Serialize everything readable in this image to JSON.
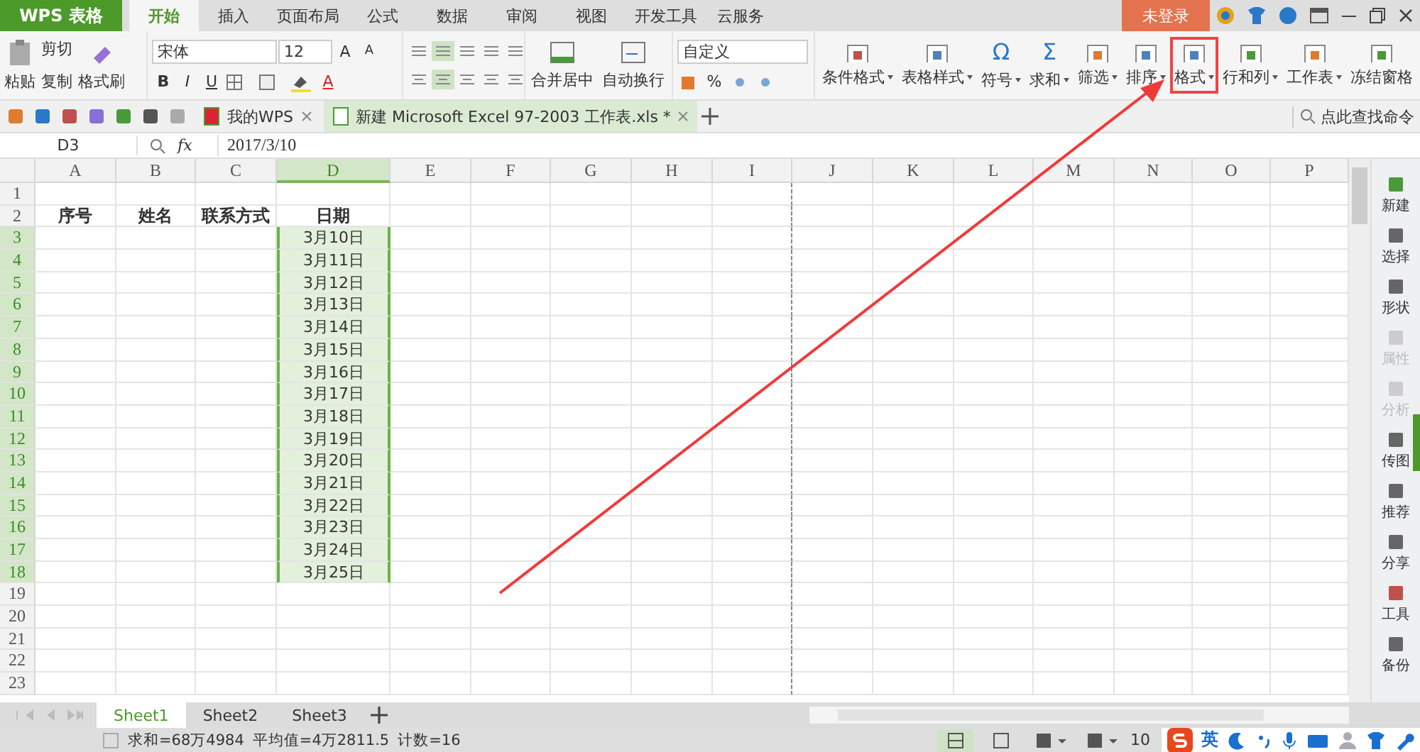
{
  "title_bar": {
    "app_button": "WPS 表格",
    "login": "未登录",
    "tabs": [
      {
        "label": "开始",
        "selected": true
      },
      {
        "label": "插入",
        "selected": false
      },
      {
        "label": "页面布局",
        "selected": false
      },
      {
        "label": "公式",
        "selected": false
      },
      {
        "label": "数据",
        "selected": false
      },
      {
        "label": "审阅",
        "selected": false
      },
      {
        "label": "视图",
        "selected": false
      },
      {
        "label": "开发工具",
        "selected": false
      },
      {
        "label": "云服务",
        "selected": false
      }
    ]
  },
  "ribbon": {
    "paste": "粘贴",
    "cut": "剪切",
    "copy": "复制",
    "format_painter": "格式刷",
    "font_name": "宋体",
    "font_size": "12",
    "grow": "A",
    "shrink": "A",
    "styles": [
      "B",
      "I",
      "U"
    ],
    "font_color": "A",
    "merge": "合并居中",
    "wrap": "自动换行",
    "number_format": "自定义",
    "percent": "%",
    "tools": [
      {
        "label": "条件格式",
        "dropdown": true,
        "highlighted": false
      },
      {
        "label": "表格样式",
        "dropdown": true,
        "highlighted": false
      },
      {
        "label": "符号",
        "glyph": "Ω",
        "dropdown": true,
        "highlighted": false
      },
      {
        "label": "求和",
        "glyph": "Σ",
        "dropdown": true,
        "highlighted": false
      },
      {
        "label": "筛选",
        "dropdown": true,
        "highlighted": false
      },
      {
        "label": "排序",
        "dropdown": true,
        "highlighted": false
      },
      {
        "label": "格式",
        "dropdown": true,
        "highlighted": true
      },
      {
        "label": "行和列",
        "dropdown": true,
        "highlighted": false
      },
      {
        "label": "工作表",
        "dropdown": true,
        "highlighted": false
      },
      {
        "label": "冻结窗格",
        "dropdown": false,
        "highlighted": false
      }
    ],
    "search": "点此查找命令"
  },
  "doc_tabs": [
    {
      "label": "我的WPS",
      "selected": false
    },
    {
      "label": "新建 Microsoft Excel 97-2003 工作表.xls *",
      "selected": true
    }
  ],
  "formula_bar": {
    "cell": "D3",
    "fx": "fx",
    "value": "2017/3/10"
  },
  "sheet": {
    "columns": [
      {
        "label": "A",
        "selected": false
      },
      {
        "label": "B",
        "selected": false
      },
      {
        "label": "C",
        "selected": false
      },
      {
        "label": "D",
        "selected": true
      },
      {
        "label": "E",
        "selected": false
      },
      {
        "label": "F",
        "selected": false
      },
      {
        "label": "G",
        "selected": false
      },
      {
        "label": "H",
        "selected": false
      },
      {
        "label": "I",
        "selected": false
      },
      {
        "label": "J",
        "selected": false
      },
      {
        "label": "K",
        "selected": false
      },
      {
        "label": "L",
        "selected": false
      },
      {
        "label": "M",
        "selected": false
      },
      {
        "label": "N",
        "selected": false
      },
      {
        "label": "O",
        "selected": false
      },
      {
        "label": "P",
        "selected": false
      }
    ],
    "rows": [
      {
        "number": "1",
        "selected": false
      },
      {
        "number": "2",
        "selected": false,
        "headings": [
          "序号",
          "姓名",
          "联系方式",
          "日期"
        ]
      },
      {
        "number": "3",
        "selected": true,
        "date": "3月10日"
      },
      {
        "number": "4",
        "selected": true,
        "date": "3月11日"
      },
      {
        "number": "5",
        "selected": true,
        "date": "3月12日"
      },
      {
        "number": "6",
        "selected": true,
        "date": "3月13日"
      },
      {
        "number": "7",
        "selected": true,
        "date": "3月14日"
      },
      {
        "number": "8",
        "selected": true,
        "date": "3月15日"
      },
      {
        "number": "9",
        "selected": true,
        "date": "3月16日"
      },
      {
        "number": "10",
        "selected": true,
        "date": "3月17日"
      },
      {
        "number": "11",
        "selected": true,
        "date": "3月18日"
      },
      {
        "number": "12",
        "selected": true,
        "date": "3月19日"
      },
      {
        "number": "13",
        "selected": true,
        "date": "3月20日"
      },
      {
        "number": "14",
        "selected": true,
        "date": "3月21日"
      },
      {
        "number": "15",
        "selected": true,
        "date": "3月22日"
      },
      {
        "number": "16",
        "selected": true,
        "date": "3月23日"
      },
      {
        "number": "17",
        "selected": true,
        "date": "3月24日"
      },
      {
        "number": "18",
        "selected": true,
        "date": "3月25日"
      },
      {
        "number": "19",
        "selected": false
      },
      {
        "number": "20",
        "selected": false
      },
      {
        "number": "21",
        "selected": false
      },
      {
        "number": "22",
        "selected": false
      },
      {
        "number": "23",
        "selected": false
      }
    ]
  },
  "sidebar": [
    {
      "label": "新建",
      "disabled": false
    },
    {
      "label": "选择",
      "disabled": false
    },
    {
      "label": "形状",
      "disabled": false
    },
    {
      "label": "属性",
      "disabled": true
    },
    {
      "label": "分析",
      "disabled": true
    },
    {
      "label": "传图",
      "disabled": false
    },
    {
      "label": "推荐",
      "disabled": false
    },
    {
      "label": "分享",
      "disabled": false
    },
    {
      "label": "工具",
      "disabled": false
    },
    {
      "label": "备份",
      "disabled": false
    }
  ],
  "sheet_tabs": [
    {
      "label": "Sheet1",
      "selected": true
    },
    {
      "label": "Sheet2",
      "selected": false
    },
    {
      "label": "Sheet3",
      "selected": false
    }
  ],
  "status_bar": {
    "items": [
      "求和=68万4984",
      "平均值=4万2811.5",
      "计数=16"
    ],
    "zoom": "10",
    "ime": "英"
  },
  "annotation": {
    "kind": "arrow"
  }
}
